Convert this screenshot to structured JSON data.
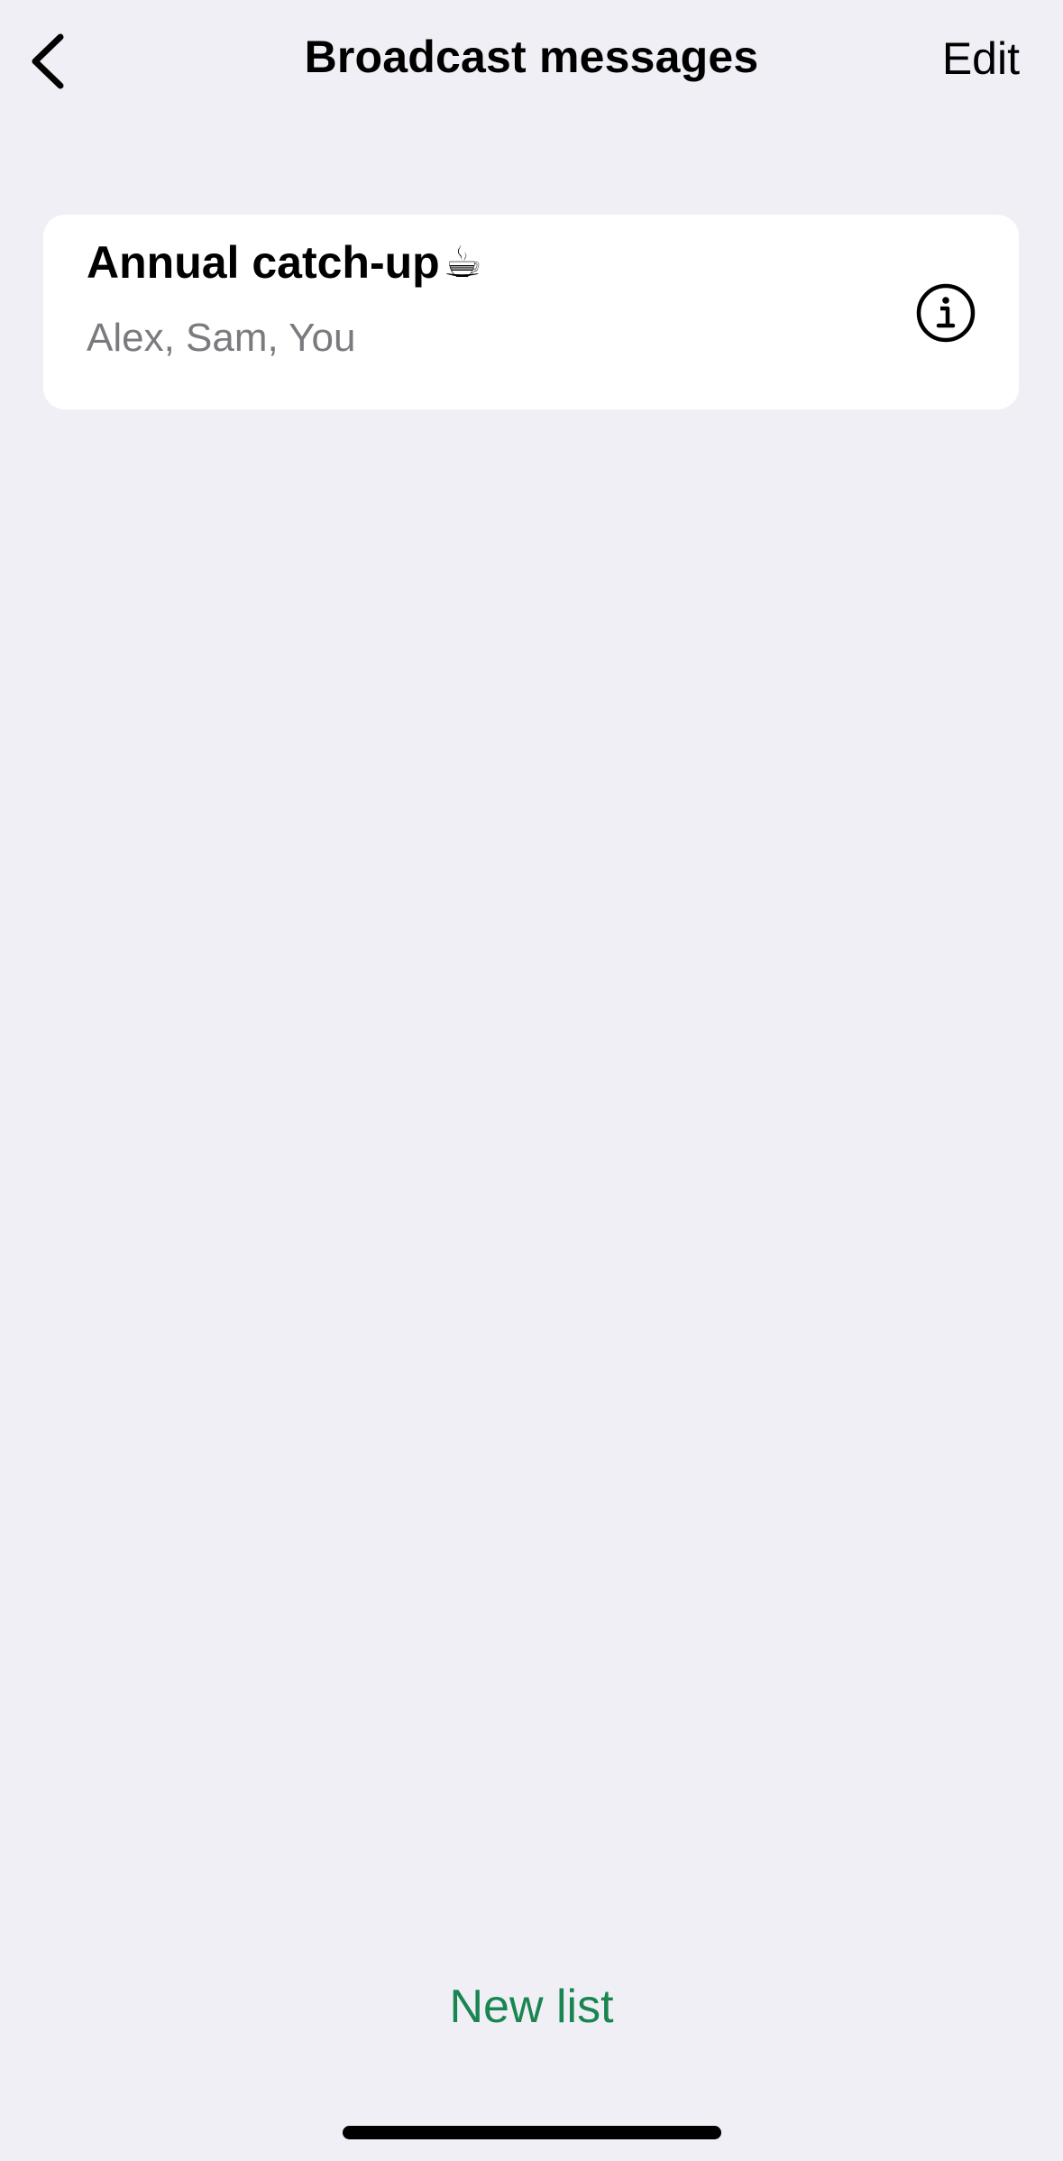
{
  "nav": {
    "title": "Broadcast messages",
    "edit_label": "Edit",
    "back_icon": "chevron-left-icon"
  },
  "broadcast_lists": [
    {
      "title": "Annual catch-up",
      "emoji": "☕",
      "members": "Alex, Sam, You",
      "info_icon": "info-circle-icon"
    }
  ],
  "footer": {
    "new_list_label": "New list"
  },
  "colors": {
    "background": "#f0eff5",
    "card": "#ffffff",
    "accent_green": "#198551",
    "secondary_text": "#7a7a7f"
  }
}
